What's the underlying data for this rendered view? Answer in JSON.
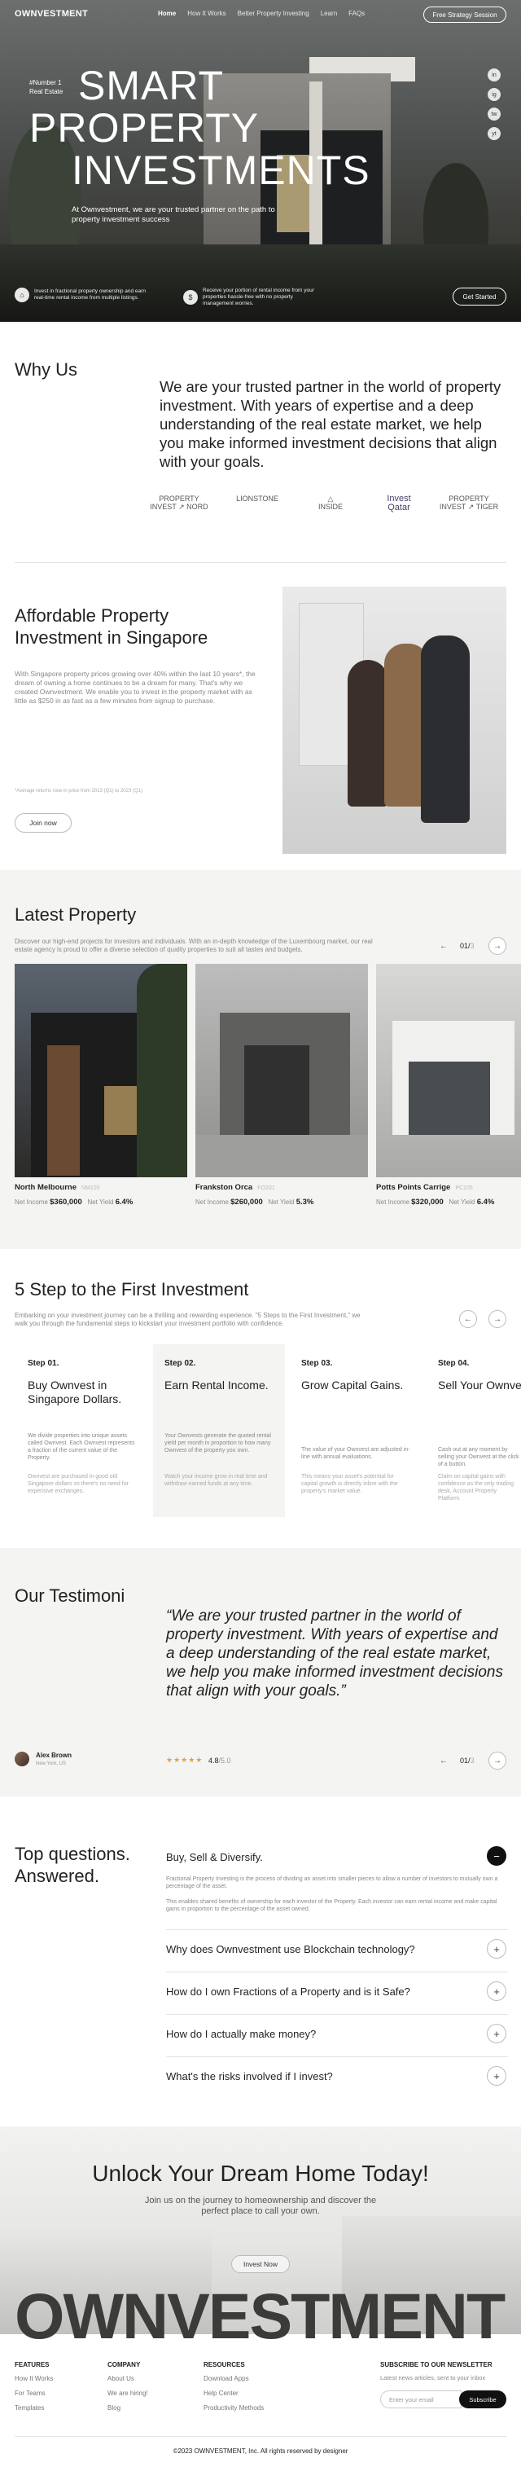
{
  "nav": {
    "logo": "OWNVESTMENT",
    "links": [
      "Home",
      "How It Works",
      "Better Property Investing",
      "Learn",
      "FAQs"
    ],
    "cta": "Free Strategy Session"
  },
  "hero": {
    "tag_line1": "#Number 1",
    "tag_line2": "Real Estate",
    "title_line1": "SMART",
    "title_line2": "PROPERTY",
    "title_line3": "INVESTMENTS",
    "subtitle": "At Ownvestment, we are your trusted partner on the path to property investment success",
    "social": [
      "in",
      "ig",
      "tw",
      "yt"
    ],
    "features": [
      {
        "icon": "building-icon",
        "text": "Invest in fractional property ownership and earn real-time rental income from multiple listings."
      },
      {
        "icon": "coin-icon",
        "text": "Receive your portion of rental income from your properties hassle-free with no property management worries."
      }
    ],
    "cta": "Get Started"
  },
  "why": {
    "title": "Why Us",
    "text": "We are your trusted partner in the world of property investment. With years of expertise and a deep understanding of the real estate market, we help you make informed investment decisions that align with your goals.",
    "partners": [
      {
        "line1": "PROPERTY",
        "line2": "INVEST ↗ NORD"
      },
      {
        "line1": "",
        "line2": "LIONSTONE"
      },
      {
        "line1": "△",
        "line2": "INSIDE"
      },
      {
        "line1": "Invest",
        "line2": "Qatar"
      },
      {
        "line1": "PROPERTY",
        "line2": "INVEST ↗ TIGER"
      }
    ]
  },
  "affordable": {
    "title_line1": "Affordable Property",
    "title_line2": "Investment in Singapore",
    "text": "With Singapore property prices growing over 40% within the last 10 years*, the dream of owning a home continues to be a dream for many. That's why we created Ownvestment. We enable you to invest in the property market with as little as $250 in as fast as a few minutes from signup to purchase.",
    "note": "*Average returns rose in price from 2013 (Q1) to 2023 (Q1)",
    "button": "Join now"
  },
  "latest": {
    "title": "Latest Property",
    "subtitle": "Discover our high-end projects for investors and individuals. With an in-depth knowledge of the Luxembourg market, our real estate agency is proud to offer a diverse selection of quality properties to suit all tastes and budgets.",
    "counter_current": "01/",
    "counter_total": "3",
    "properties": [
      {
        "name": "North Melbourne",
        "tag": "NM105",
        "income_label": "Net Income",
        "income": "$360,000",
        "yield_label": "Net Yield",
        "yield": "6.4%"
      },
      {
        "name": "Frankston Orca",
        "tag": "FO201",
        "income_label": "Net Income",
        "income": "$260,000",
        "yield_label": "Net Yield",
        "yield": "5.3%"
      },
      {
        "name": "Potts Points Carrige",
        "tag": "PC105",
        "income_label": "Net Income",
        "income": "$320,000",
        "yield_label": "Net Yield",
        "yield": "6.4%"
      }
    ]
  },
  "steps": {
    "title": "5 Step to the First Investment",
    "subtitle": "Embarking on your investment journey can be a thrilling and rewarding experience. \"5 Steps to the First Investment,\" we walk you through the fundamental steps to kickstart your investment portfolio with confidence.",
    "items": [
      {
        "num": "Step 01.",
        "title": "Buy Ownvest in Singapore Dollars.",
        "body": "We divide properties into unique assets called Ownvest. Each Ownvest represents a fraction of the current value of the Property.",
        "body2": "Ownvest are purchased in good old Singapore dollars so there's no need for expensive exchanges."
      },
      {
        "num": "Step 02.",
        "title": "Earn Rental Income.",
        "body": "Your Ownvests generate the quoted rental yield per month in proportion to how many Ownvest of the property you own.",
        "body2": "Watch your income grow in real time and withdraw earned funds at any time."
      },
      {
        "num": "Step 03.",
        "title": "Grow Capital Gains.",
        "body": "The value of your Ownvest are adjusted in-line with annual evaluations.",
        "body2": "This means your asset's potential for capital growth is directly inline with the property's market value."
      },
      {
        "num": "Step 04.",
        "title": "Sell Your Ownvest",
        "body": "Cash out at any moment by selling your Ownvest at the click of a button.",
        "body2": "Claim on capital gains with confidence as the only trading desk, Account Property Platform."
      }
    ]
  },
  "testimoni": {
    "title": "Our Testimoni",
    "quote": "“We are your trusted partner in the world of property investment. With years of expertise and a deep understanding of the real estate market, we help you make informed investment decisions that align with your goals.”",
    "name": "Alex Brown",
    "location": "New York, US",
    "rating": "4.8",
    "rating_max": "/5.0",
    "counter_current": "01/",
    "counter_total": "3"
  },
  "faq": {
    "title_line1": "Top questions.",
    "title_line2": "Answered.",
    "items": [
      {
        "q": "Buy, Sell & Diversify.",
        "open": true,
        "a1": "Fractional Property Investing is the process of dividing an asset into smaller pieces to allow a number of investors to mutually own a percentage of the asset.",
        "a2": "This enables shared benefits of ownership for each investor of the Property. Each investor can earn rental income and make capital gains in proportion to the percentage of the asset owned."
      },
      {
        "q": "Why does Ownvestment use Blockchain technology?",
        "open": false
      },
      {
        "q": "How do I own Fractions of a Property and is it Safe?",
        "open": false
      },
      {
        "q": "How do I actually make money?",
        "open": false
      },
      {
        "q": "What's the risks involved if I invest?",
        "open": false
      }
    ]
  },
  "cta": {
    "title": "Unlock Your Dream Home Today!",
    "subtitle": "Join us on the journey to homeownership and discover the perfect place to call your own.",
    "button": "Invest Now",
    "brand": "OWNVESTMENT"
  },
  "footer": {
    "features_title": "FEATURES",
    "features": [
      "How It Works",
      "For Teams",
      "Templates"
    ],
    "company_title": "COMPANY",
    "company": [
      "About Us",
      "We are hiring!",
      "Blog"
    ],
    "resources_title": "RESOURCES",
    "resources": [
      "Download Apps",
      "Help Center",
      "Productivity Methods"
    ],
    "newsletter_title": "SUBSCRIBE TO OUR NEWSLETTER",
    "newsletter_sub": "Latest news articles, sent to your inbox",
    "email_placeholder": "Enter your email",
    "subscribe": "Subscribe",
    "copyright": "©2023 OWNVESTMENT, Inc. All rights reserved by designer"
  }
}
